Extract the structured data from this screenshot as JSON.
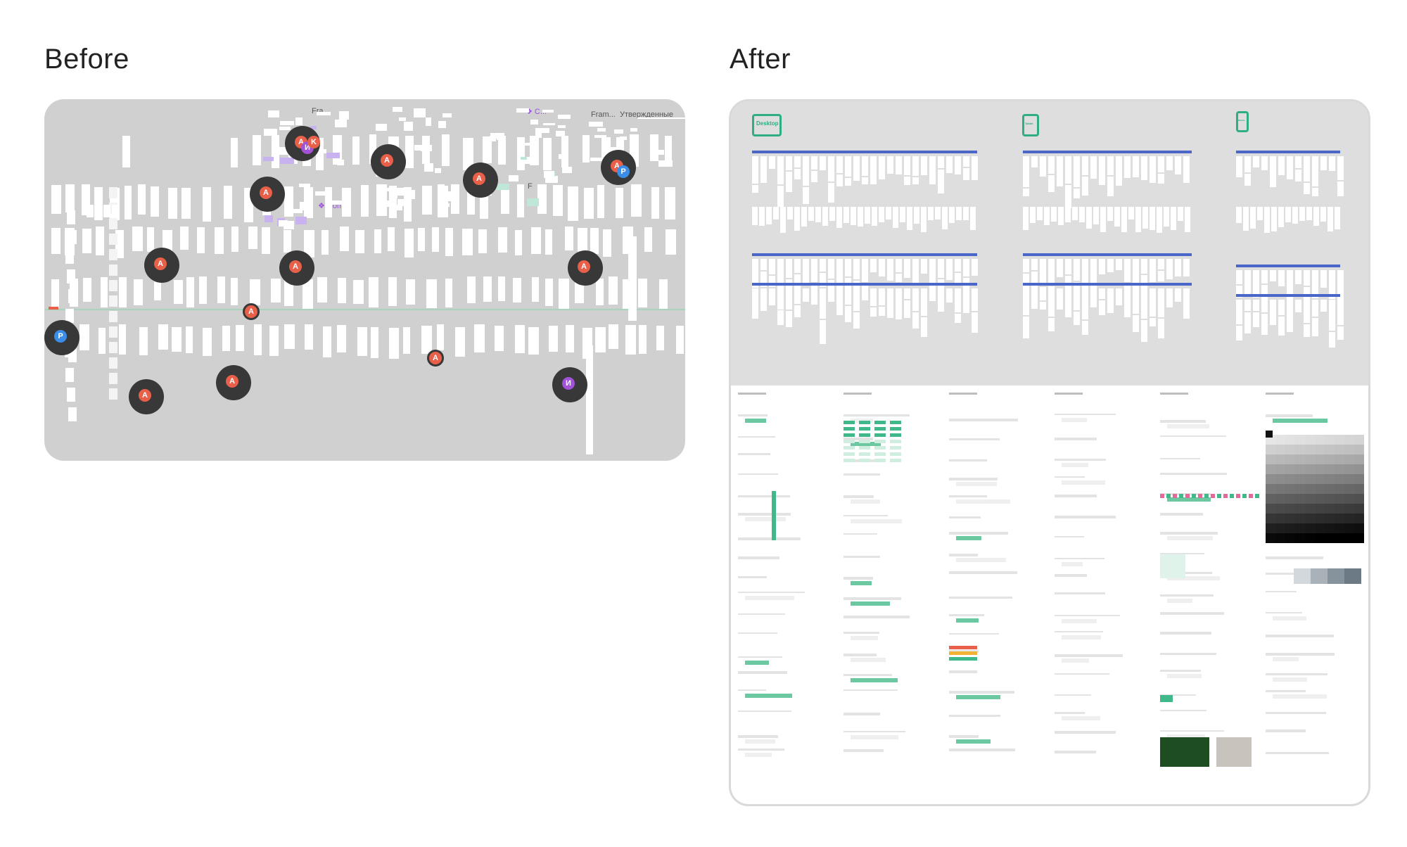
{
  "labels": {
    "before": "Before",
    "after": "After"
  },
  "before_canvas": {
    "frame_labels": [
      "Fra...",
      "Fram...",
      "Утвержденные",
      "❖ C...",
      "❖ Com",
      "F"
    ],
    "cursors": [
      "A",
      "И",
      "K",
      "P"
    ]
  },
  "after_canvas": {
    "devices": [
      "Desktop",
      "Tablet",
      "Mobile"
    ]
  },
  "colors": {
    "accent": "#2fae85",
    "blue_bar": "#4a66c8",
    "avatar_orange": "#e8604a",
    "avatar_purple": "#a152d6",
    "avatar_blue": "#3b8de8"
  }
}
